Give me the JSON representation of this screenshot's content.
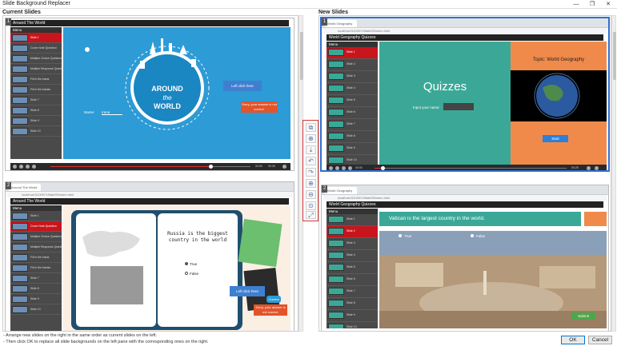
{
  "window": {
    "title": "Slide Background Replacer"
  },
  "current": {
    "section_label": "Current Slides",
    "slide1": {
      "number": "1",
      "header": "Around The World",
      "menu_title": "Menu",
      "menu_items": [
        "Slide 1",
        "Cover Note Question",
        "Multiple Choice Question",
        "Multiple Response Question",
        "Fill in the blank",
        "Fill in the blanks",
        "Slide 7",
        "Slide 8",
        "Slide 9",
        "Slide 10"
      ],
      "logo_line1": "AROUND",
      "logo_line2": "the",
      "logo_line3": "WORLD",
      "name_label": "Name:",
      "name_value": "Irene",
      "left_click": "Left click here",
      "wrong_msg": "Sorry, your answer is not correct.",
      "time_left": "00:00",
      "time_right": "00:26"
    },
    "slide2": {
      "number": "2",
      "tab_label": "Around The World",
      "url": "localhost:51000/7d9ab0f3/index.html",
      "header": "Around The World",
      "menu_title": "Menu",
      "menu_items": [
        "Slide 1",
        "Cover Note Question",
        "Multiple Choice Question",
        "Multiple Response Question",
        "Fill in the blank",
        "Fill in the blanks",
        "Slide 7",
        "Slide 8",
        "Slide 9",
        "Slide 10"
      ],
      "question": "Russia is the biggest country in the world",
      "opt_true": "True",
      "opt_false": "False",
      "left_click": "Left click here",
      "correct": "Correct",
      "wrong_msg": "Sorry, your answer is not correct."
    }
  },
  "new": {
    "section_label": "New Slides",
    "slide1": {
      "number": "1",
      "tab_label": "World Geography Quizzes",
      "url": "localhost:51000/7d9ab0f3/index.html",
      "header": "World Geography Quizzes",
      "menu_title": "Menu",
      "menu_items": [
        "Slide 1",
        "Slide 2",
        "Slide 3",
        "Slide 4",
        "Slide 5",
        "Slide 6",
        "Slide 7",
        "Slide 8",
        "Slide 9",
        "Slide 10"
      ],
      "quiz_title": "Quizzes",
      "name_label": "Input your name:",
      "topic": "Topic: World Geography",
      "start": "Start",
      "time_left": "00:00",
      "time_right": "00:26"
    },
    "slide2": {
      "number": "2",
      "tab_label": "World Geography Quizzes",
      "url": "localhost:51000/7d9ab0f3/index.html",
      "header": "World Geography Quizzes",
      "menu_title": "Menu",
      "menu_items": [
        "Slide 1",
        "Slide 2",
        "Slide 3",
        "Slide 4",
        "Slide 5",
        "Slide 6",
        "Slide 7",
        "Slide 8",
        "Slide 9",
        "Slide 10"
      ],
      "question": "Vatican is the largest country in the world.",
      "opt_true": "True",
      "opt_false": "False",
      "submit": "Submit"
    }
  },
  "tools": [
    "copy-icon",
    "paste-icon",
    "download-icon",
    "undo-icon",
    "redo-icon",
    "zoom-in-icon",
    "zoom-out-icon",
    "zoom-reset-icon",
    "fit-icon"
  ],
  "footer": {
    "line1": "- Arrange new slides on the right in the same order as current slides on the left.",
    "line2": "- Then click OK to replace all slide backgrounds on the left pane with the corresponding ones on the right.",
    "ok": "OK",
    "cancel": "Cancel"
  },
  "colors": {
    "accent_red": "#c8151c",
    "blue": "#2c9bd6",
    "teal": "#3ba897",
    "orange": "#f08a4b"
  }
}
